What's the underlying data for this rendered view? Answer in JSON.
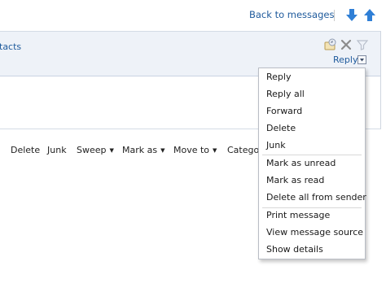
{
  "header": {
    "back_link": "Back to messages",
    "next_icon": "down-arrow-icon",
    "prev_icon": "up-arrow-icon"
  },
  "message": {
    "contacts_link": "tacts",
    "reply_label": "Reply",
    "icons": [
      "flag-icon",
      "delete-x-icon",
      "filter-icon",
      "chevron-down-icon"
    ]
  },
  "toolbar": {
    "delete": "Delete",
    "junk": "Junk",
    "sweep": "Sweep",
    "mark_as": "Mark as",
    "move_to": "Move to",
    "categories": "Catego"
  },
  "reply_menu": {
    "group1": [
      "Reply",
      "Reply all",
      "Forward",
      "Delete",
      "Junk"
    ],
    "group2": [
      "Mark as unread",
      "Mark as read",
      "Delete all from sender"
    ],
    "group3": [
      "Print message",
      "View message source",
      "Show details"
    ]
  },
  "colors": {
    "link": "#1e5a9c",
    "arrow": "#2f7fd6",
    "header_bg": "#eef2f8"
  }
}
